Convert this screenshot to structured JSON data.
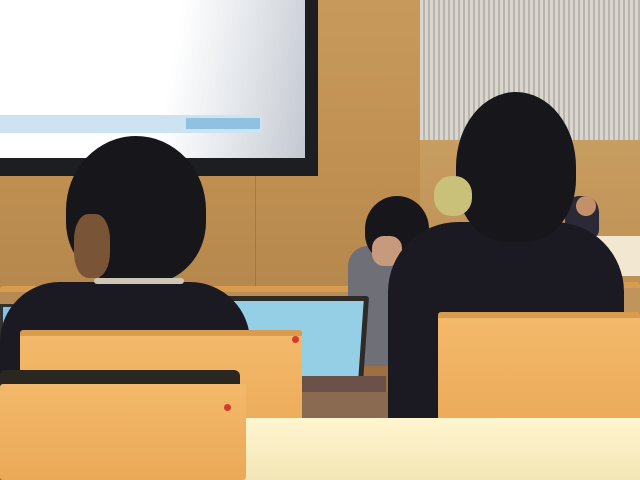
{
  "scene": {
    "description_tags": [
      "lecture-hall",
      "projector-screen",
      "audience",
      "laptop"
    ],
    "colors": {
      "wood_wall": "#c79a5c",
      "chair": "#f3b96a",
      "screen": "#ffffff",
      "laptop_screen": "#94cfe6"
    }
  }
}
